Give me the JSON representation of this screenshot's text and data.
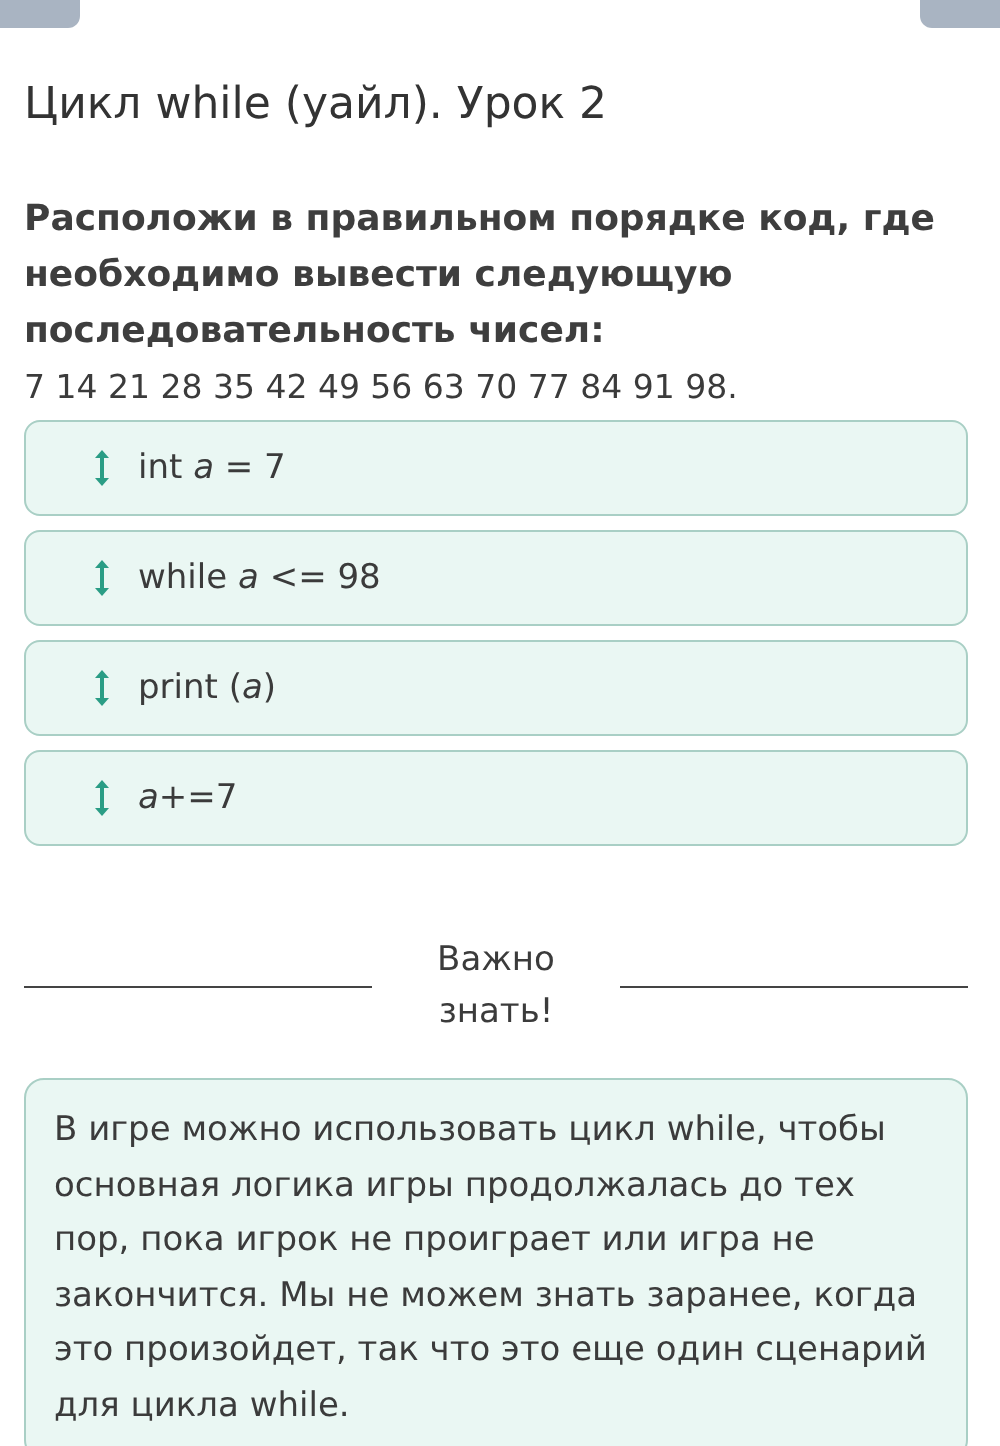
{
  "title": "Цикл while (уайл). Урок 2",
  "question": "Расположи в правильном порядке код, где необходимо вывести следующую последовательность чисел:",
  "sequence": "7 14 21 28 35 42 49 56 63 70 77 84 91 98.",
  "code_lines": [
    {
      "text": "int *a* = 7"
    },
    {
      "text": "while *a* <= 98"
    },
    {
      "text": "print (*a*)"
    },
    {
      "text": "*a*+=7"
    }
  ],
  "divider_label": "Важно знать!",
  "info": "В игре можно использовать цикл while, чтобы основная логика игры продолжалась до тех пор, пока игрок не проиграет или игра не закончится. Мы не можем знать заранее, когда это произойдет, так что это еще один сценарий для цикла while."
}
